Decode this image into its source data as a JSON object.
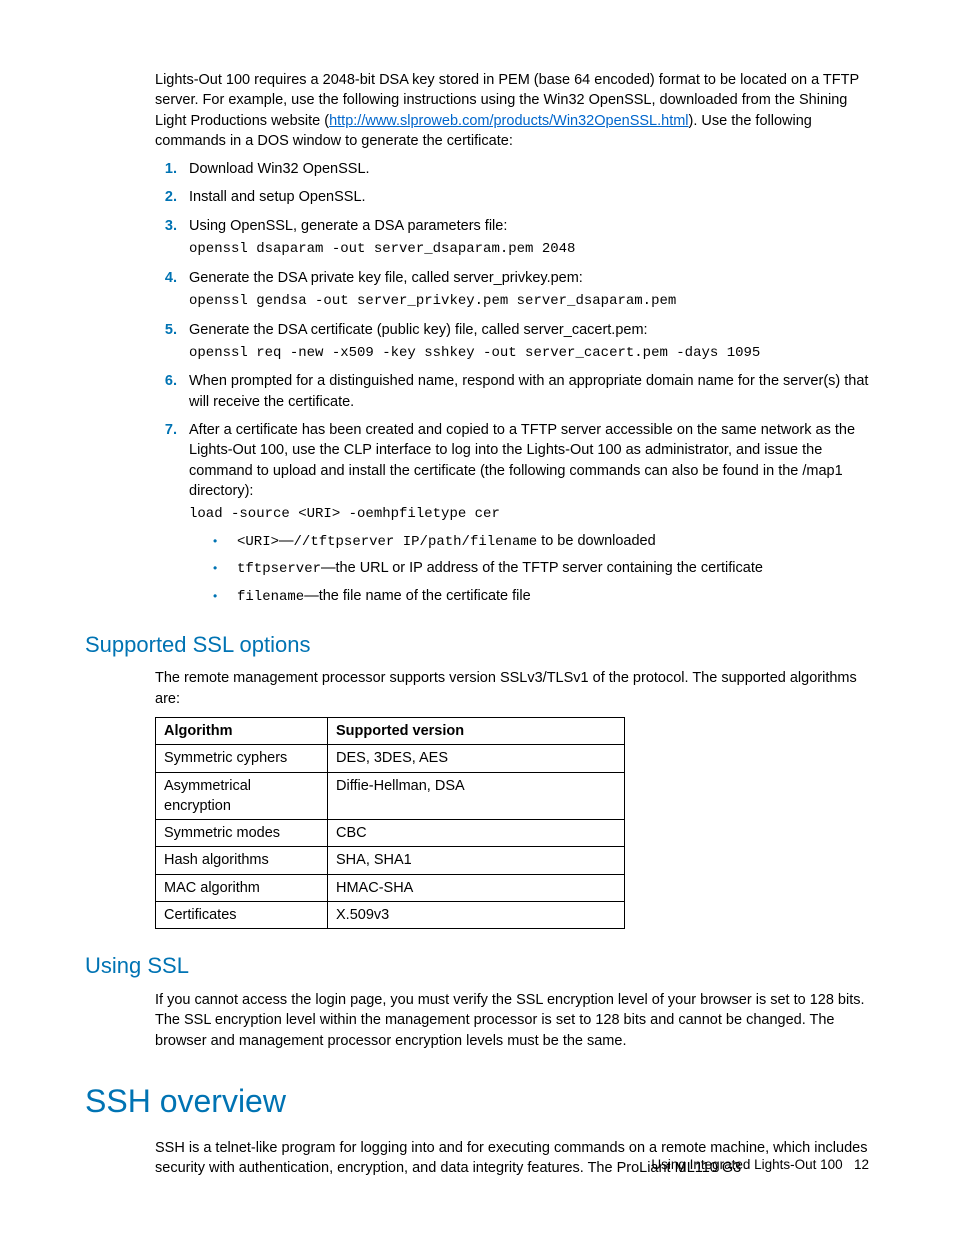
{
  "intro": {
    "text1": "Lights-Out 100 requires a 2048-bit DSA key stored in PEM (base 64 encoded) format to be located on a TFTP server. For example, use the following instructions using the Win32 OpenSSL, downloaded from the Shining Light Productions website (",
    "link": "http://www.slproweb.com/products/Win32OpenSSL.html",
    "text2": "). Use the following commands in a DOS window to generate the certificate:"
  },
  "steps": {
    "s1_num": "1.",
    "s1_text": "Download Win32 OpenSSL.",
    "s2_num": "2.",
    "s2_text": "Install and setup OpenSSL.",
    "s3_num": "3.",
    "s3_text": "Using OpenSSL, generate a DSA parameters file:",
    "s3_cmd": "openssl dsaparam -out server_dsaparam.pem 2048",
    "s4_num": "4.",
    "s4_text": "Generate the DSA private key file, called server_privkey.pem:",
    "s4_cmd": "openssl gendsa -out server_privkey.pem server_dsaparam.pem",
    "s5_num": "5.",
    "s5_text": "Generate the DSA certificate (public key) file, called server_cacert.pem:",
    "s5_cmd": "openssl req -new -x509 -key sshkey -out server_cacert.pem -days 1095",
    "s6_num": "6.",
    "s6_text": "When prompted for a distinguished name, respond with an appropriate domain name for the server(s) that will receive the certificate.",
    "s7_num": "7.",
    "s7_text": "After a certificate has been created and copied to a TFTP server accessible on the same network as the Lights-Out 100, use the CLP interface to log into the Lights-Out 100 as administrator, and issue the command to upload and install the certificate (the following commands can also be found in the /map1 directory):",
    "s7_cmd": "load -source <URI> -oemhpfiletype cer",
    "b1_code": "<URI>",
    "b1_dash": "—",
    "b1_code2": "//tftpserver IP/path/filename",
    "b1_text": " to be downloaded",
    "b2_code": "tftpserver",
    "b2_text": "—the URL or IP address of the TFTP server containing the certificate",
    "b3_code": "filename",
    "b3_text": "—the file name of the certificate file"
  },
  "ssl_options": {
    "heading": "Supported SSL options",
    "body": "The remote management processor supports version SSLv3/TLSv1 of the protocol. The supported algorithms are:",
    "th1": "Algorithm",
    "th2": "Supported version",
    "r1c1": "Symmetric cyphers",
    "r1c2": "DES, 3DES, AES",
    "r2c1": "Asymmetrical encryption",
    "r2c2": "Diffie-Hellman, DSA",
    "r3c1": "Symmetric modes",
    "r3c2": "CBC",
    "r4c1": "Hash algorithms",
    "r4c2": "SHA, SHA1",
    "r5c1": "MAC algorithm",
    "r5c2": "HMAC-SHA",
    "r6c1": "Certificates",
    "r6c2": "X.509v3"
  },
  "using_ssl": {
    "heading": "Using SSL",
    "body": "If you cannot access the login page, you must verify the SSL encryption level of your browser is set to 128 bits. The SSL encryption level within the management processor is set to 128 bits and cannot be changed. The browser and management processor encryption levels must be the same."
  },
  "ssh": {
    "heading": "SSH overview",
    "body": "SSH is a telnet-like program for logging into and for executing commands on a remote machine, which includes security with authentication, encryption, and data integrity features. The ProLiant ML110 G3"
  },
  "footer": {
    "text": "Using Integrated Lights-Out 100",
    "page": "12"
  }
}
